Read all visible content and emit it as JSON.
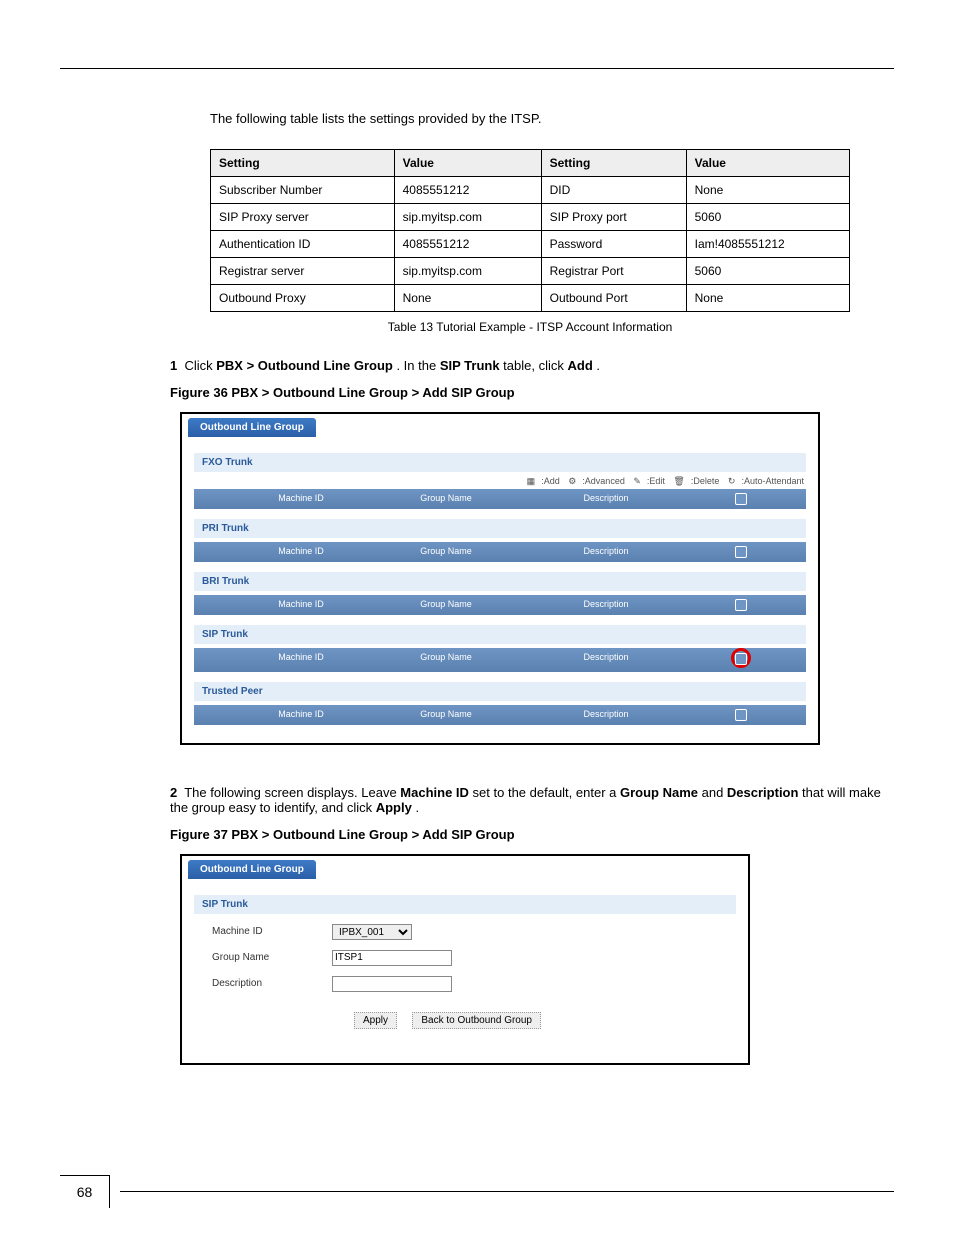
{
  "page": {
    "number": "68"
  },
  "intro": "The following table lists the settings provided by the ITSP.",
  "table": {
    "headers": [
      "Setting",
      "Value",
      "Setting",
      "Value"
    ],
    "rows": [
      [
        "Subscriber Number",
        "4085551212",
        "DID",
        "None"
      ],
      [
        "SIP Proxy server",
        "sip.myitsp.com",
        "SIP Proxy port",
        "5060"
      ],
      [
        "Authentication ID",
        "4085551212",
        "Password",
        "Iam!4085551212"
      ],
      [
        "Registrar server",
        "sip.myitsp.com",
        "Registrar Port",
        "5060"
      ],
      [
        "Outbound Proxy",
        "None",
        "Outbound Port",
        "None"
      ]
    ],
    "caption": "Table 13 Tutorial Example - ITSP Account Information"
  },
  "steps": {
    "s1": {
      "num": "1",
      "body_a": "Click ",
      "bold_b": "PBX > Outbound Line Group",
      "body_c": ". In the ",
      "bold_d": "SIP Trunk ",
      "body_e": "table, click ",
      "bold_f": "Add",
      "body_g": "."
    },
    "s1_caption": "Figure 36 PBX > Outbound Line Group > Add SIP Group",
    "s2": {
      "num": "2",
      "body_a": "The following screen displays. Leave ",
      "bold_b": "Machine ID ",
      "body_c": "set to the default, enter a ",
      "bold_d": "Group Name ",
      "body_e": "and\n",
      "bold_f": "Description ",
      "body_g": "that will make the group easy to identify, and click ",
      "bold_h": "Apply",
      "body_i": "."
    },
    "s2_caption": "Figure 37 PBX > Outbound Line Group > Add SIP Group"
  },
  "panel1": {
    "tab": "Outbound Line Group",
    "sections": [
      "FXO Trunk",
      "PRI Trunk",
      "BRI Trunk",
      "SIP Trunk",
      "Trusted Peer"
    ],
    "legend": {
      "add": ":Add",
      "advanced": ":Advanced",
      "edit": ":Edit",
      "delete": ":Delete",
      "auto": ":Auto-Attendant"
    },
    "cols": [
      "",
      "Machine ID",
      "Group Name",
      "Description",
      ""
    ]
  },
  "panel2": {
    "tab": "Outbound Line Group",
    "section": "SIP Trunk",
    "fields": {
      "machine_id_label": "Machine ID",
      "machine_id_value": "IPBX_001",
      "group_name_label": "Group Name",
      "group_name_value": "ITSP1",
      "description_label": "Description",
      "description_value": ""
    },
    "buttons": {
      "apply": "Apply",
      "back": "Back to Outbound Group"
    }
  }
}
